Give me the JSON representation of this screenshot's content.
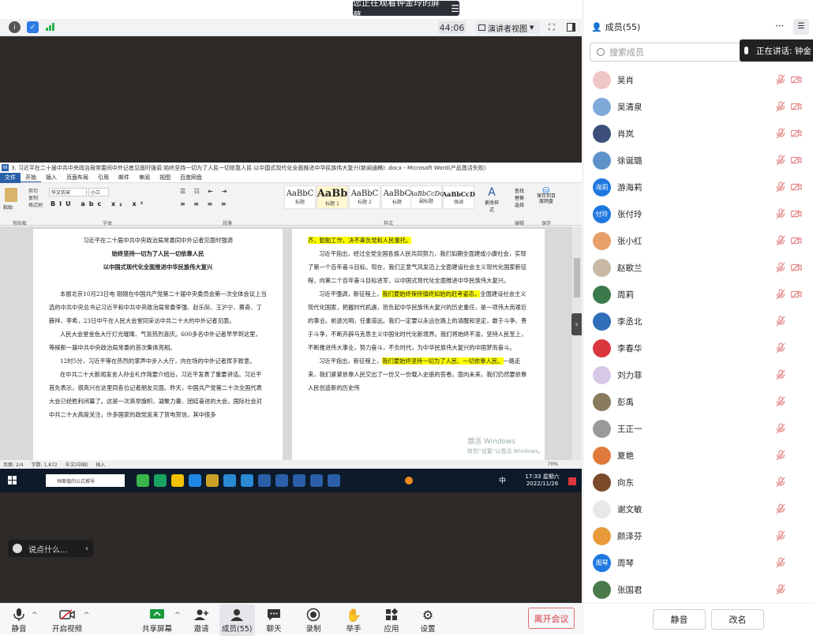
{
  "banner": {
    "text": "您正在观看钟金玲的屏幕"
  },
  "window_controls": {
    "minimize": "—",
    "maximize": "☐",
    "close": "✕"
  },
  "infobar": {
    "timer": "44:06",
    "view_label": "演讲者视图"
  },
  "word": {
    "title": "3. 习近平在二十届中共中央政治局常委同中外记者见面时强调 始终坚持一切为了人民一切依靠人民 以中国式现代化全面推进中华民族伟大复兴(新闻通稿) .docx - Microsoft Word(产品激活失败)",
    "tabs": [
      "文件",
      "开始",
      "插入",
      "页面布局",
      "引用",
      "邮件",
      "审阅",
      "视图",
      "百度网盘"
    ],
    "font_name": "华文仿宋",
    "font_size": "小三",
    "clipboard": [
      "粘贴",
      "剪切",
      "复制",
      "格式刷"
    ],
    "group_labels": [
      "剪贴板",
      "字体",
      "段落",
      "样式",
      "编辑",
      "保存"
    ],
    "styles": [
      {
        "sample": "AaBbC",
        "name": "标题"
      },
      {
        "sample": "AaBb",
        "name": "标题 1"
      },
      {
        "sample": "AaBbC",
        "name": "标题 2"
      },
      {
        "sample": "AaBbC",
        "name": "标题"
      },
      {
        "sample": "AaBbCcDc",
        "name": "副标题"
      },
      {
        "sample": "AaBbCcD",
        "name": "强调"
      }
    ],
    "edit_items": [
      "查找",
      "替换",
      "选择"
    ],
    "change_style": "更改样式",
    "save_baidu": "保存到百度网盘",
    "page1": {
      "heading": "习近平在二十届中共中央政治局常委同中外记者见面时强调",
      "sub1": "始终坚持一切为了人民一切依靠人民",
      "sub2": "以中国式现代化全面推进中华民族伟大复兴",
      "p1": "本报北京10月23日电 刚刚在中国共产党第二十届中央委员会第一次全体会议上当选的中共中央总书记习近平和中共中央政治局常委李强、赵乐际、王沪宁、蔡奇、丁薛祥、李希，23日中午在人民大会堂同采访中共二十大的中外记者见面。",
      "p2": "人民大会堂金色大厅灯光璀璨、气氛热烈喜庆。600多名中外记者早早到这里，等候新一届中共中央政治局常委的首次集体亮相。",
      "p3": "12时5分，习近平等在热烈的掌声中步入大厅，向在场的中外记者挥手致意。",
      "p4": "在中共二十大新闻发言人孙业礼作简要介绍后，习近平发表了重要讲话。习近平首先表示，很高兴在这里同各位记者朋友见面。昨天，中国共产党第二十次全国代表大会已经胜利闭幕了。这是一次高举旗帜、凝聚力量、团结奋进的大会。国际社会对中共二十大高度关注，许多国家的政党发来了贺电贺信，其中很多"
    },
    "page2": {
      "p0": "齐，勤勉工作，决不辜负党和人民重托。",
      "p1": "习近平指出，经过全党全国各族人民共同努力，我们如期全面建成小康社会，实现了第一个百年奋斗目标。现在，我们正意气风发迈上全面建设社会主义现代化国家新征程，向第二个百年奋斗目标进军，以中国式现代化全面推进中华民族伟大复兴。",
      "p2a": "习近平强调，新征程上，",
      "p2b": "我们要始终保持慎终如始的赶考姿态，",
      "p2c": "全面建设社会主义现代化国家，把握时代机遇，担负起中华民族伟大复兴的历史重任，是一项伟大而艰巨的事业。前途光明，任重道远。我们一定要以永远在路上的清醒和坚定，敢于斗争、善于斗争，不断开辟马克思主义中国化时代化新境界。我们将始终不渝，坚持人民至上，不断推进伟大事业，努力奋斗，不负时代，为中华民族伟大复兴的中国梦而奋斗。",
      "p3a": "习近平指出，新征程上，",
      "p3b": "我们要始终坚持一切为了人民、一切依靠人民。",
      "p3c": "一路走来，我们紧紧依靠人民交出了一份又一份载入史册的答卷。面向未来，我们仍然要依靠人民创造新的历史伟"
    },
    "status": {
      "page": "页面: 2/4",
      "words": "字数: 1,872",
      "lang": "中文(中国)",
      "mode": "插入",
      "zoom": "70%"
    },
    "taskbar": {
      "search": "钟面值的公式推导",
      "clock_time": "17:33 星期六",
      "clock_date": "2022/11/26",
      "ime": "中"
    },
    "watermark": [
      "激活 Windows",
      "转到“设置”以激活 Windows。"
    ]
  },
  "chat": {
    "placeholder": "说点什么..."
  },
  "toolbar": {
    "mute": "静音",
    "video": "开启视频",
    "share": "共享屏幕",
    "invite": "邀请",
    "members": "成员(55)",
    "chat": "聊天",
    "record": "录制",
    "raise_hand": "举手",
    "apps": "应用",
    "settings": "设置",
    "leave": "离开会议"
  },
  "panel": {
    "title": "成员(55)",
    "more": "···",
    "search_placeholder": "搜索成员",
    "speaking": "正在讲话: 钟金",
    "members": [
      {
        "name": "吴肖",
        "avatar": "",
        "color": "#f0c6c6",
        "cam": true
      },
      {
        "name": "吴清泉",
        "avatar": "",
        "color": "#7fa9d8",
        "cam": true
      },
      {
        "name": "肖岚",
        "avatar": "",
        "color": "#3b4f7a",
        "cam": true
      },
      {
        "name": "徐诞璐",
        "avatar": "",
        "color": "#5d93c8",
        "cam": true
      },
      {
        "name": "游海莉",
        "avatar": "海莉",
        "color": "#1f78e0",
        "cam": true
      },
      {
        "name": "张付玲",
        "avatar": "付玲",
        "color": "#1f78e0",
        "cam": true
      },
      {
        "name": "张小红",
        "avatar": "",
        "color": "#e8a06a",
        "cam": true
      },
      {
        "name": "赵歌兰",
        "avatar": "",
        "color": "#c8b8a4",
        "cam": true
      },
      {
        "name": "周莉",
        "avatar": "",
        "color": "#3b7a4a",
        "cam": true
      },
      {
        "name": "李丞北",
        "avatar": "",
        "color": "#2f6eb8",
        "cam": false
      },
      {
        "name": "李春华",
        "avatar": "",
        "color": "#d9363e",
        "cam": false
      },
      {
        "name": "刘力菲",
        "avatar": "",
        "color": "#d7c8e8",
        "cam": false
      },
      {
        "name": "彭禹",
        "avatar": "",
        "color": "#8a7a5e",
        "cam": false
      },
      {
        "name": "王正一",
        "avatar": "",
        "color": "#9a9a9a",
        "cam": false
      },
      {
        "name": "夏艳",
        "avatar": "",
        "color": "#e07a3a",
        "cam": false
      },
      {
        "name": "向东",
        "avatar": "",
        "color": "#7a4a2a",
        "cam": false
      },
      {
        "name": "谢文敏",
        "avatar": "",
        "color": "#e8e8e8",
        "cam": false
      },
      {
        "name": "颜泽芬",
        "avatar": "",
        "color": "#e89a3a",
        "cam": false
      },
      {
        "name": "周琴",
        "avatar": "周琴",
        "color": "#1f78e0",
        "cam": false
      },
      {
        "name": "张国君",
        "avatar": "",
        "color": "#4a7a4a",
        "cam": false
      }
    ],
    "mute_all": "静音",
    "rename": "改名"
  }
}
